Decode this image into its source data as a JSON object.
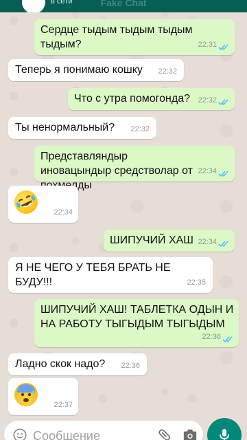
{
  "header": {
    "status": "в сети",
    "app_watermark": "Fake Chat"
  },
  "colors": {
    "header": "#075e54",
    "outgoing_bubble": "#dcf8c6",
    "incoming_bubble": "#ffffff",
    "read_ticks": "#4fc3f7",
    "accent": "#00897b"
  },
  "messages": [
    {
      "dir": "out",
      "text": "Сердце тыдым тыдым тыдым тыдым?",
      "time": "22:31",
      "read": true
    },
    {
      "dir": "in",
      "text": "Теперь я понимаю кошку",
      "time": "22:32"
    },
    {
      "dir": "out",
      "text": "Что с утра помогонда?",
      "time": "22:32",
      "read": true
    },
    {
      "dir": "in",
      "text": "Ты ненормальный?",
      "time": "22:32"
    },
    {
      "dir": "out",
      "text": "Представляндыр иновацындыр средстволар от похмелды",
      "time": "22:34",
      "read": true
    },
    {
      "dir": "in",
      "emoji": "rolling-on-floor-laughing",
      "time": "22:34"
    },
    {
      "dir": "out",
      "text": "ШИПУЧИЙ ХАШ",
      "time": "22:34",
      "read": true
    },
    {
      "dir": "in",
      "text": "Я НЕ ЧЕГО У ТЕБЯ БРАТЬ НЕ БУДУ!!!",
      "time": "22:35"
    },
    {
      "dir": "out",
      "text": "ШИПУЧИЙ ХАШ! ТАБЛЕТКА ОДЫН И НА РАБОТУ ТЫГЫДЫМ ТЫГЫДЫМ",
      "time": "22:36",
      "read": true
    },
    {
      "dir": "in",
      "text": "Ладно скок надо?",
      "time": "22:36"
    },
    {
      "dir": "in",
      "emoji": "anxious-face-with-sweat",
      "time": "22:37"
    }
  ],
  "composer": {
    "placeholder": "Сообщение",
    "icons": [
      "emoji-icon",
      "attach-icon",
      "camera-icon",
      "mic-icon"
    ]
  }
}
